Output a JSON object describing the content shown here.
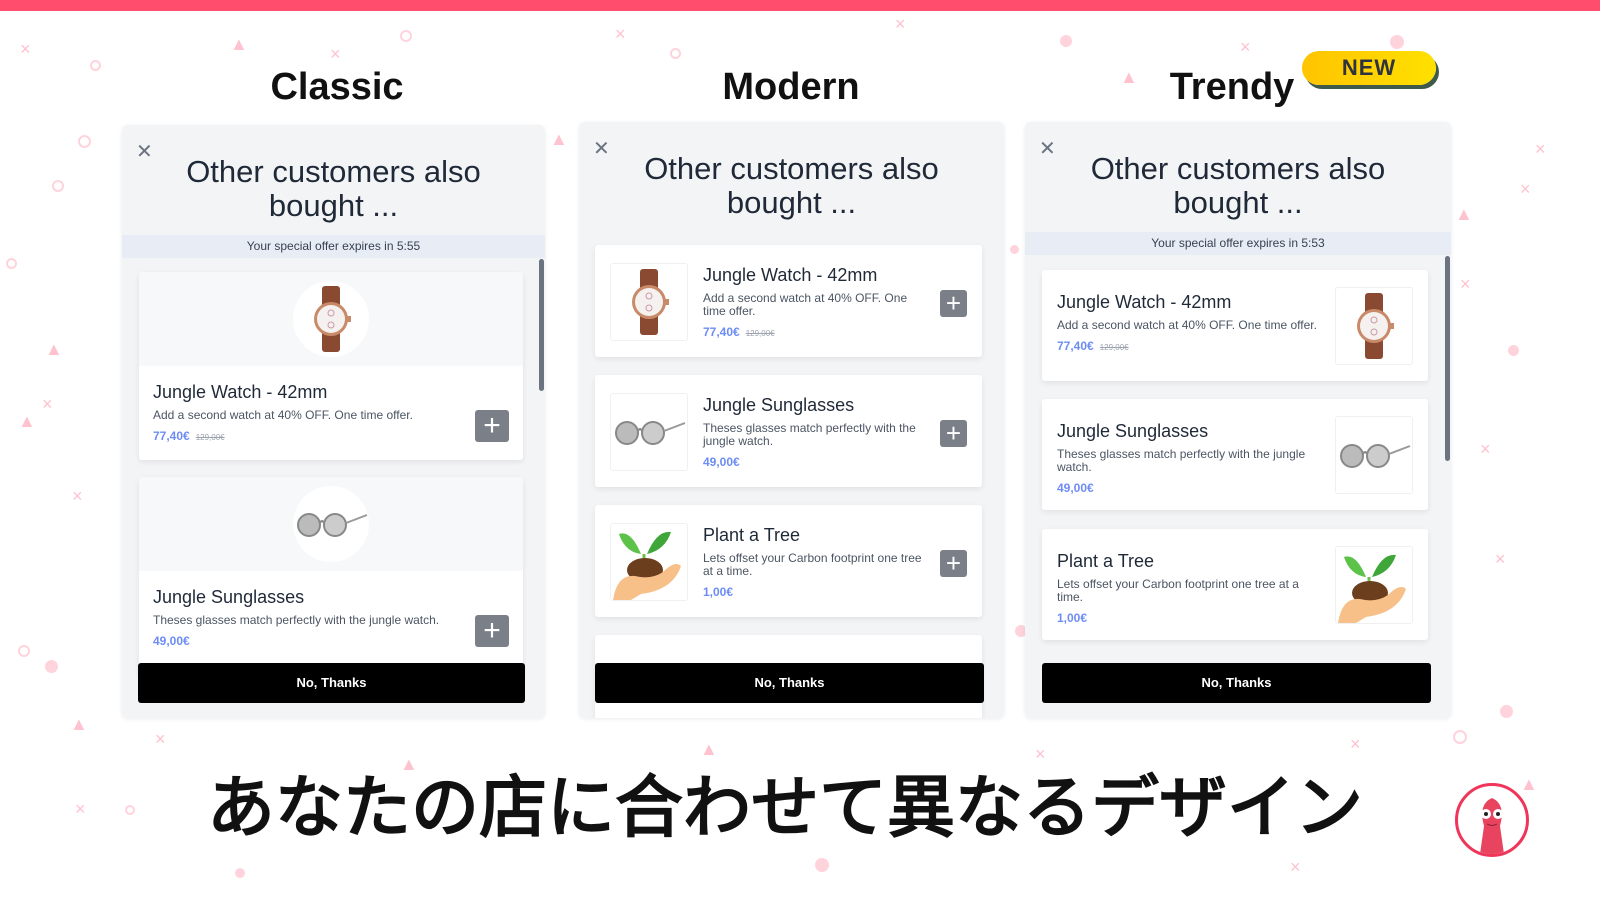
{
  "colors": {
    "accent": "#ff4d6d",
    "price": "#6d8cf5",
    "badge": "#ffd000"
  },
  "styles": [
    {
      "title": "Classic"
    },
    {
      "title": "Modern"
    },
    {
      "title": "Trendy",
      "badge": "NEW"
    }
  ],
  "popup": {
    "title": "Other customers also bought ...",
    "no_thanks": "No, Thanks",
    "classic_timer": "Your special offer expires in 5:55",
    "trendy_timer": "Your special offer expires in 5:53"
  },
  "products": [
    {
      "name": "Jungle Watch - 42mm",
      "desc": "Add a second watch at 40% OFF. One time offer.",
      "price": "77,40€",
      "old_price": "129,00€",
      "icon": "watch"
    },
    {
      "name": "Jungle Sunglasses",
      "desc": "Theses glasses match perfectly with the jungle watch.",
      "price": "49,00€",
      "icon": "sunglasses"
    },
    {
      "name": "Plant a Tree",
      "desc": "Lets offset your Carbon footprint one tree at a time.",
      "price": "1,00€",
      "icon": "plant-in-hand"
    }
  ],
  "caption": "あなたの店に合わせて異なるデザイン",
  "avatar": "mascot-avatar"
}
